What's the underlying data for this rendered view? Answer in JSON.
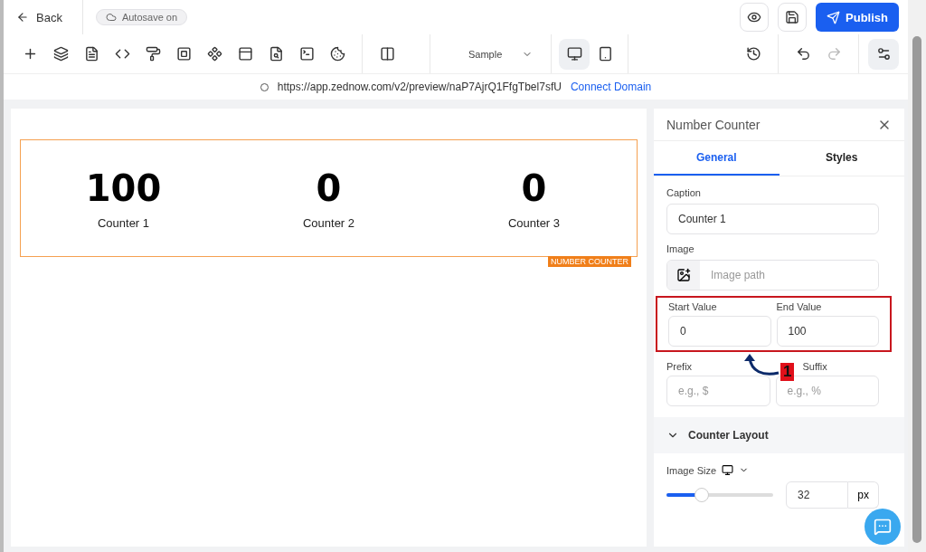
{
  "header": {
    "back": "Back",
    "autosave": "Autosave on",
    "publish": "Publish"
  },
  "toolbar": {
    "page_select": "Sample",
    "devices": [
      {
        "kind": "desktop",
        "selected": true
      },
      {
        "kind": "mobile",
        "selected": false
      }
    ],
    "redo_disabled": true
  },
  "url_bar": {
    "url": "https://app.zednow.com/v2/preview/naP7AjrQ1FfgTbel7sfU",
    "link": "Connect Domain"
  },
  "canvas": {
    "counters": [
      {
        "value": "100",
        "caption": "Counter 1"
      },
      {
        "value": "0",
        "caption": "Counter 2"
      },
      {
        "value": "0",
        "caption": "Counter 3"
      }
    ],
    "block_tag": "NUMBER COUNTER"
  },
  "panel": {
    "title": "Number Counter",
    "tabs": [
      {
        "label": "General",
        "selected": true
      },
      {
        "label": "Styles",
        "selected": false
      }
    ],
    "caption": {
      "label": "Caption",
      "value": "Counter 1"
    },
    "image": {
      "label": "Image",
      "placeholder": "Image path"
    },
    "start": {
      "label": "Start Value",
      "value": "0"
    },
    "end": {
      "label": "End Value",
      "value": "100"
    },
    "prefix": {
      "label": "Prefix",
      "placeholder": "e.g., $"
    },
    "suffix": {
      "label": "Suffix",
      "placeholder": "e.g., %"
    },
    "section": {
      "title": "Counter Layout",
      "expanded": true
    },
    "image_size": {
      "label": "Image Size",
      "level": 0.33,
      "value": "32",
      "unit": "px"
    }
  },
  "annotation": {
    "number": "1"
  }
}
